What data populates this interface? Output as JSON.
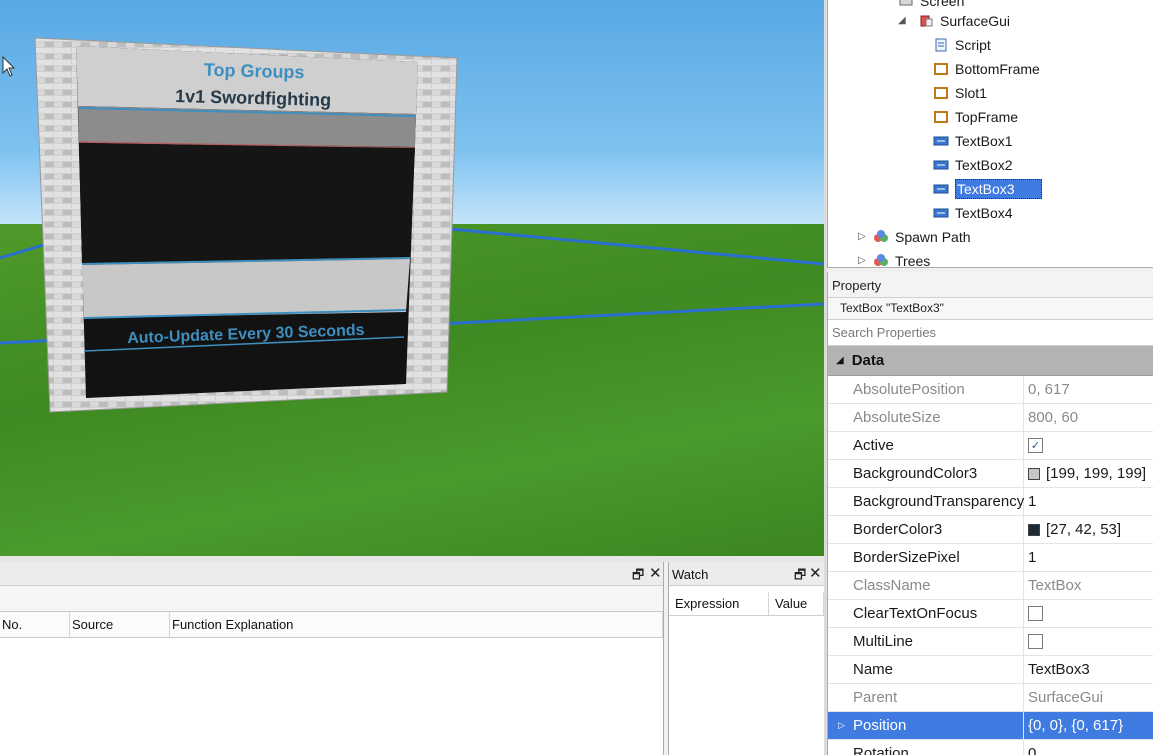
{
  "viewport": {
    "billboard_title": "Top Groups",
    "billboard_subtitle": "1v1 Swordfighting",
    "billboard_footer": "Auto-Update Every 30 Seconds"
  },
  "explorer": {
    "items": [
      {
        "label": "Screen",
        "icon": "screen-icon"
      },
      {
        "label": "SurfaceGui",
        "icon": "surfacegui-icon"
      },
      {
        "label": "Script",
        "icon": "script-icon"
      },
      {
        "label": "BottomFrame",
        "icon": "frame-icon"
      },
      {
        "label": "Slot1",
        "icon": "frame-icon"
      },
      {
        "label": "TopFrame",
        "icon": "frame-icon"
      },
      {
        "label": "TextBox1",
        "icon": "textbox-icon"
      },
      {
        "label": "TextBox2",
        "icon": "textbox-icon"
      },
      {
        "label": "TextBox3",
        "icon": "textbox-icon"
      },
      {
        "label": "TextBox4",
        "icon": "textbox-icon"
      },
      {
        "label": "Spawn Path",
        "icon": "model-icon"
      },
      {
        "label": "Trees",
        "icon": "model-icon"
      }
    ],
    "selected": "TextBox3"
  },
  "properties": {
    "header": "Property",
    "object": "TextBox \"TextBox3\"",
    "search_placeholder": "Search Properties",
    "section": "Data",
    "rows": [
      {
        "name": "AbsolutePosition",
        "value": "0, 617",
        "readonly": true
      },
      {
        "name": "AbsoluteSize",
        "value": "800, 60",
        "readonly": true
      },
      {
        "name": "Active",
        "value": "",
        "checkbox": true,
        "checked": true
      },
      {
        "name": "BackgroundColor3",
        "value": "[199, 199, 199]",
        "swatch": "#c7c7c7"
      },
      {
        "name": "BackgroundTransparency",
        "value": "1"
      },
      {
        "name": "BorderColor3",
        "value": "[27, 42, 53]",
        "swatch": "#1b2a35"
      },
      {
        "name": "BorderSizePixel",
        "value": "1"
      },
      {
        "name": "ClassName",
        "value": "TextBox",
        "readonly": true
      },
      {
        "name": "ClearTextOnFocus",
        "value": "",
        "checkbox": true,
        "checked": false
      },
      {
        "name": "MultiLine",
        "value": "",
        "checkbox": true,
        "checked": false
      },
      {
        "name": "Name",
        "value": "TextBox3"
      },
      {
        "name": "Parent",
        "value": "SurfaceGui",
        "readonly": true
      },
      {
        "name": "Position",
        "value": "{0, 0}, {0, 617}",
        "selected": true
      },
      {
        "name": "Rotation",
        "value": "0"
      }
    ]
  },
  "output": {
    "columns": [
      "No.",
      "Source",
      "Function Explanation"
    ]
  },
  "watch": {
    "title": "Watch",
    "columns": [
      "Expression",
      "Value"
    ]
  },
  "colors": {
    "selection": "#3f7be0",
    "section_bg": "#b3b3b3",
    "billboard_text": "#3d8fc0"
  }
}
